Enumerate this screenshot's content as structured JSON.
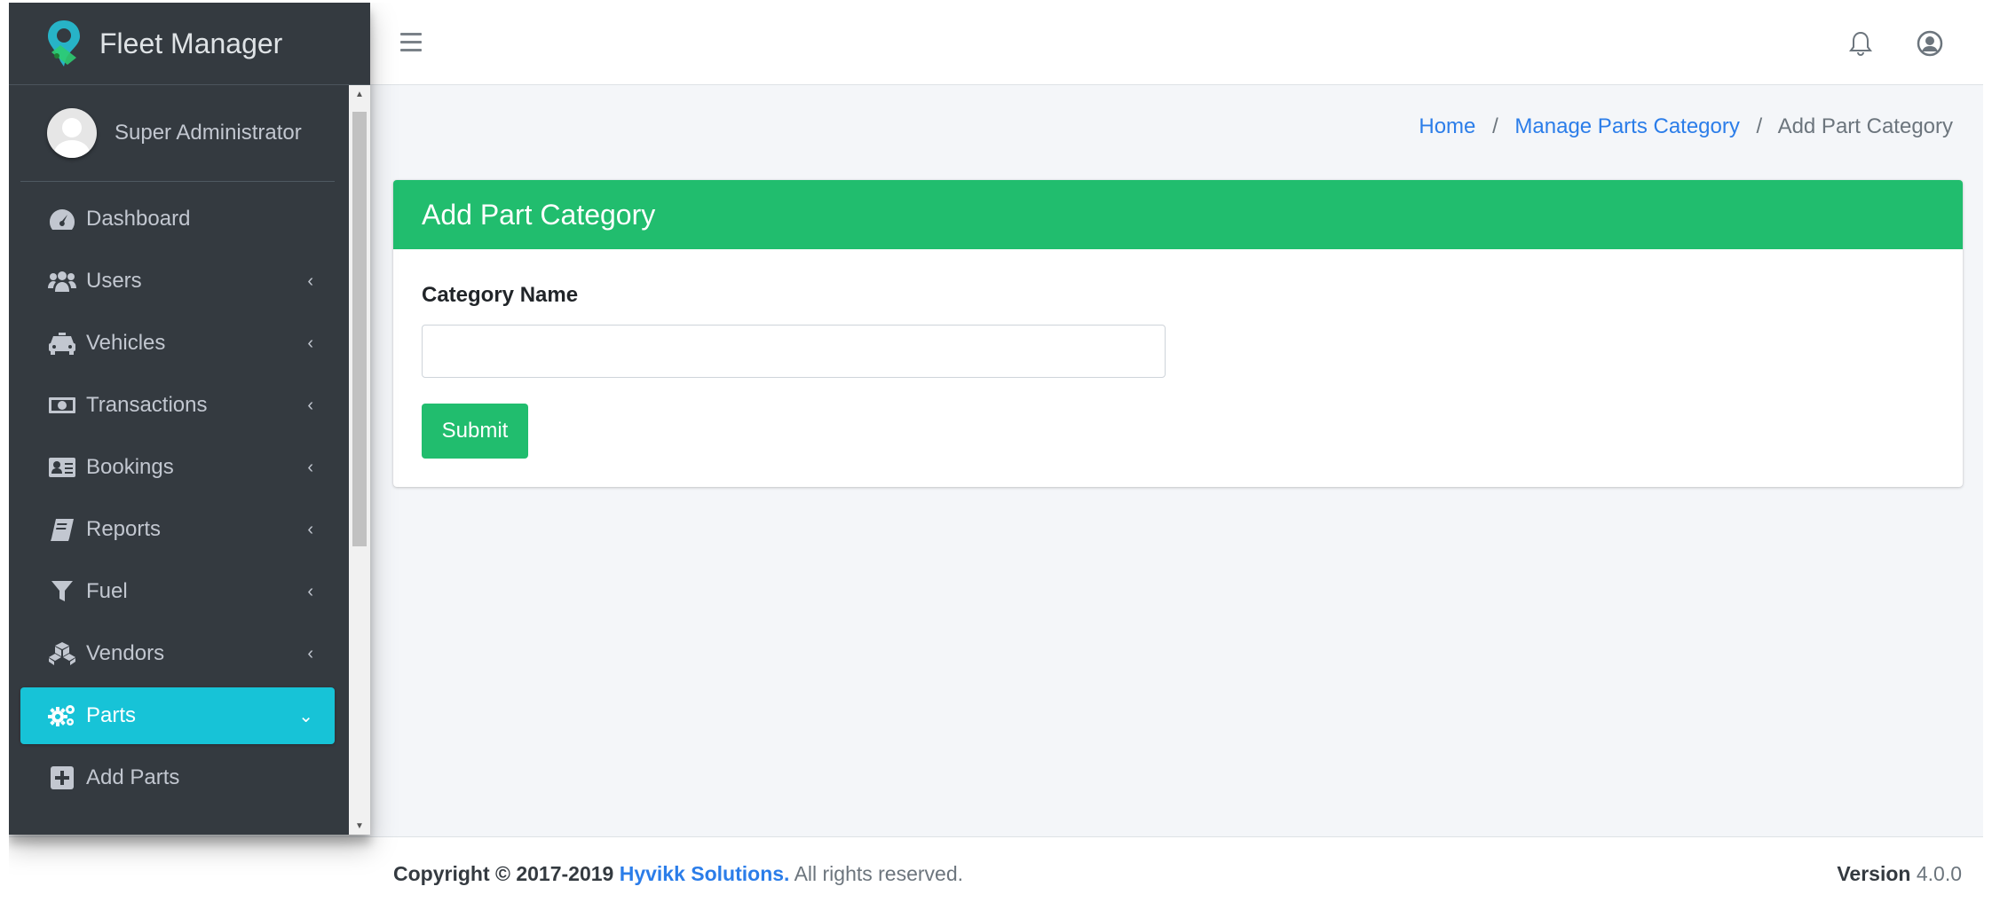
{
  "brand": {
    "name": "Fleet Manager"
  },
  "user": {
    "name": "Super Administrator"
  },
  "sidebar": {
    "items": [
      {
        "label": "Dashboard",
        "icon": "tachometer-icon",
        "has_submenu": false
      },
      {
        "label": "Users",
        "icon": "users-icon",
        "has_submenu": true
      },
      {
        "label": "Vehicles",
        "icon": "taxi-icon",
        "has_submenu": true
      },
      {
        "label": "Transactions",
        "icon": "money-bill-icon",
        "has_submenu": true
      },
      {
        "label": "Bookings",
        "icon": "address-card-icon",
        "has_submenu": true
      },
      {
        "label": "Reports",
        "icon": "book-icon",
        "has_submenu": true
      },
      {
        "label": "Fuel",
        "icon": "filter-icon",
        "has_submenu": true
      },
      {
        "label": "Vendors",
        "icon": "cubes-icon",
        "has_submenu": true
      },
      {
        "label": "Parts",
        "icon": "cogs-icon",
        "has_submenu": true,
        "active": true,
        "expanded": true
      },
      {
        "label": "Add Parts",
        "icon": "plus-square-icon",
        "has_submenu": false
      }
    ]
  },
  "breadcrumb": {
    "home": "Home",
    "separator": "/",
    "parent": "Manage Parts Category",
    "current": "Add Part Category"
  },
  "card": {
    "title": "Add Part Category",
    "field_label": "Category Name",
    "field_value": "",
    "submit_label": "Submit"
  },
  "footer": {
    "copyright_prefix": "Copyright © 2017-2019",
    "company": "Hyvikk Solutions.",
    "rights": "All rights reserved.",
    "version_label": "Version",
    "version_number": "4.0.0"
  },
  "colors": {
    "sidebar_bg": "#343a40",
    "active_nav": "#17c3d7",
    "card_header": "#21bd6e",
    "link": "#2b7de9",
    "content_bg": "#f4f6f9"
  }
}
